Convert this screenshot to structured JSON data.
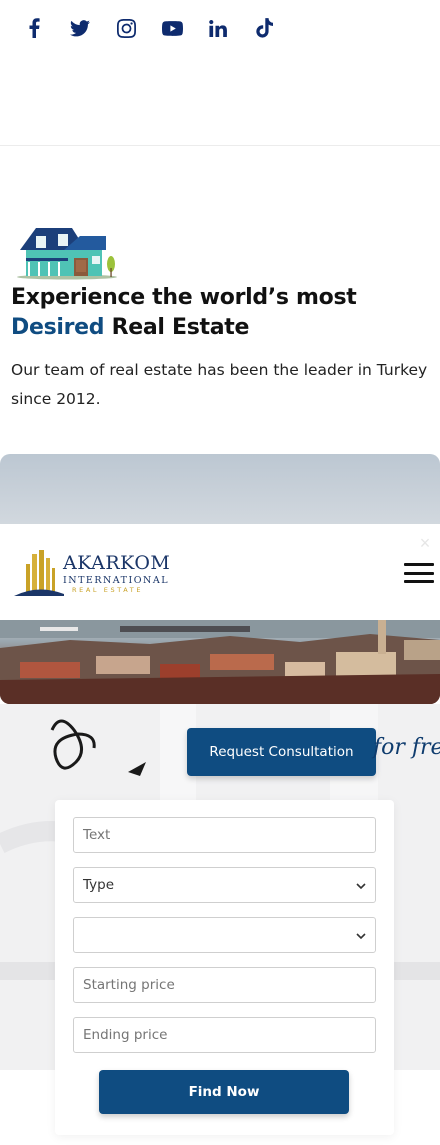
{
  "social": {
    "icons": [
      "facebook-icon",
      "twitter-icon",
      "instagram-icon",
      "youtube-icon",
      "linkedin-icon",
      "tiktok-icon"
    ],
    "color": "#0e2b6e"
  },
  "hero": {
    "headline_line1": "Experience the world’s most",
    "headline_accent": "Desired",
    "headline_line2_rest": " Real Estate",
    "intro": "Our team of real estate has been the leader in Turkey since 2012."
  },
  "header": {
    "logo_brand": "AKARKOM",
    "logo_sub": "INTERNATIONAL",
    "logo_sub2": "REAL ESTATE",
    "close_glyph": "×",
    "menu_icon": "hamburger-menu-icon"
  },
  "banner": {
    "consult_label": "Request Consultation",
    "script_text": "for fre"
  },
  "search": {
    "text_placeholder": "Text",
    "type_selected": "Type",
    "second_select": "",
    "start_price_placeholder": "Starting price",
    "end_price_placeholder": "Ending price",
    "submit_label": "Find Now"
  },
  "colors": {
    "brand_blue": "#0f4c81",
    "logo_navy": "#1b3668",
    "logo_gold": "#c9a227"
  }
}
